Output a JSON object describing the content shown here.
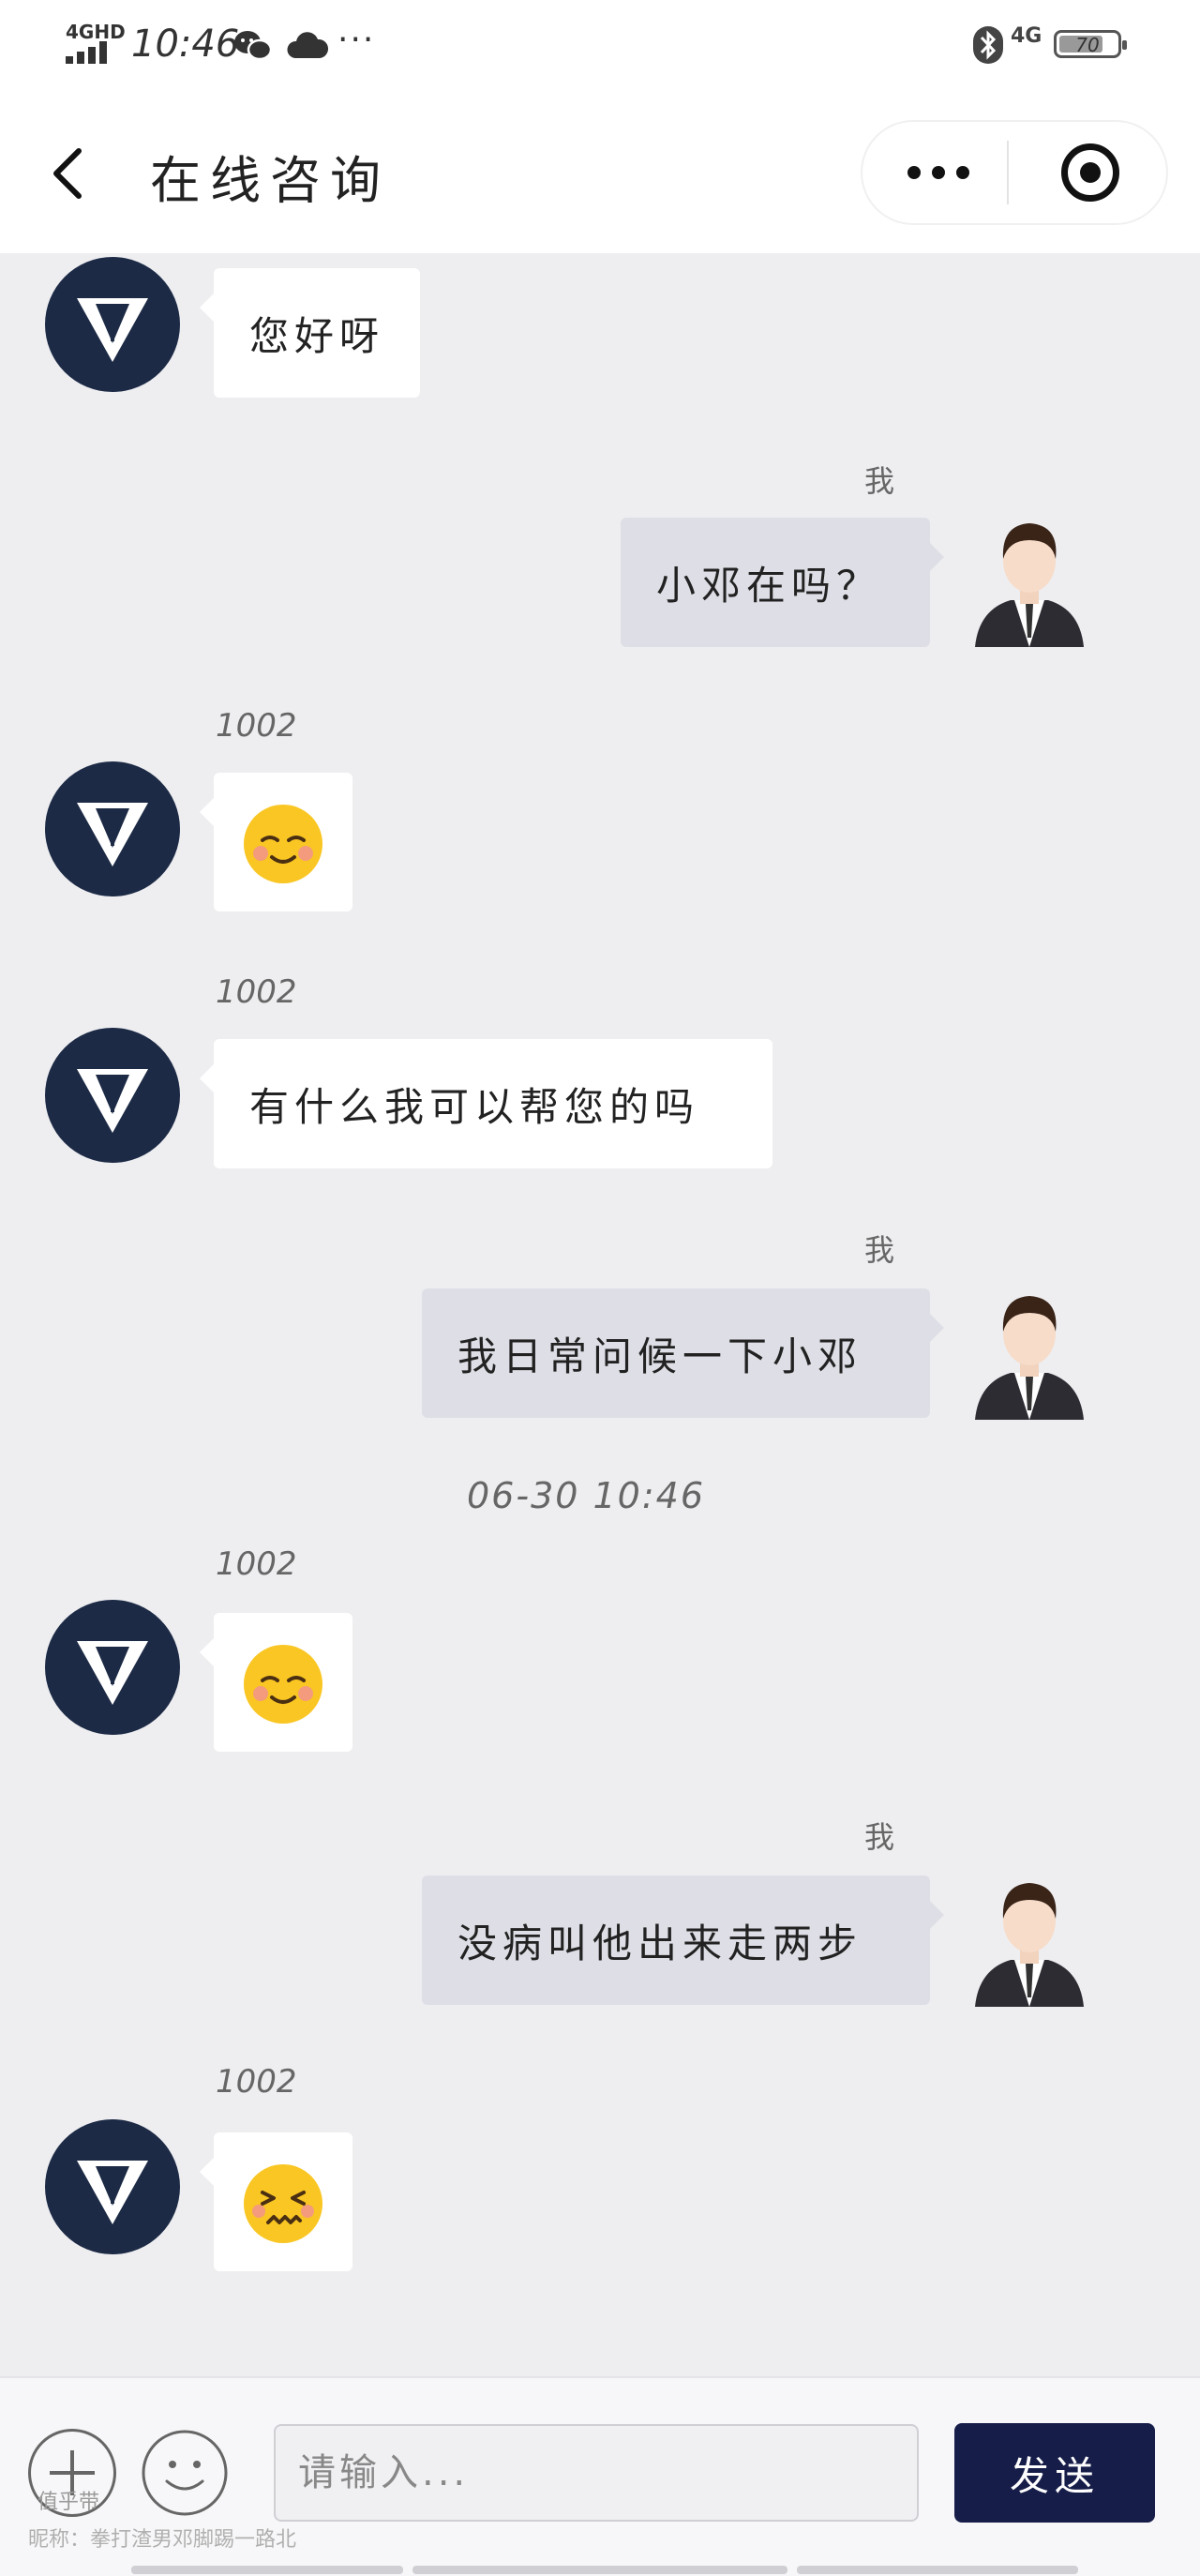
{
  "status_bar": {
    "network": "4GHD",
    "time": "10:46",
    "more": "···",
    "right_network": "4G",
    "battery": "70"
  },
  "header": {
    "title": "在线咨询"
  },
  "messages": [
    {
      "from": "agent",
      "text": "您好呀"
    },
    {
      "from": "me",
      "sender": "我",
      "text": "小邓在吗？"
    },
    {
      "from": "agent",
      "sender": "1002",
      "emoji": "happy-blush-emoji"
    },
    {
      "from": "agent",
      "sender": "1002",
      "text": "有什么我可以帮您的吗"
    },
    {
      "from": "me",
      "sender": "我",
      "text": "我日常问候一下小邓"
    },
    {
      "from": "agent",
      "sender": "1002",
      "emoji": "happy-blush-emoji"
    },
    {
      "from": "me",
      "sender": "我",
      "text": "没病叫他出来走两步"
    },
    {
      "from": "agent",
      "sender": "1002",
      "emoji": "squint-emoji"
    }
  ],
  "timestamp": "06-30 10:46",
  "input": {
    "placeholder": "请输入...",
    "send_label": "发送"
  },
  "watermark": {
    "logo": "值乎带",
    "nickname": "昵称：拳打渣男邓脚踢一路北"
  },
  "colors": {
    "agent_avatar": "#1c2a45",
    "send_button": "#161d48",
    "my_bubble": "#dedfe6",
    "background": "#eeeef1"
  }
}
